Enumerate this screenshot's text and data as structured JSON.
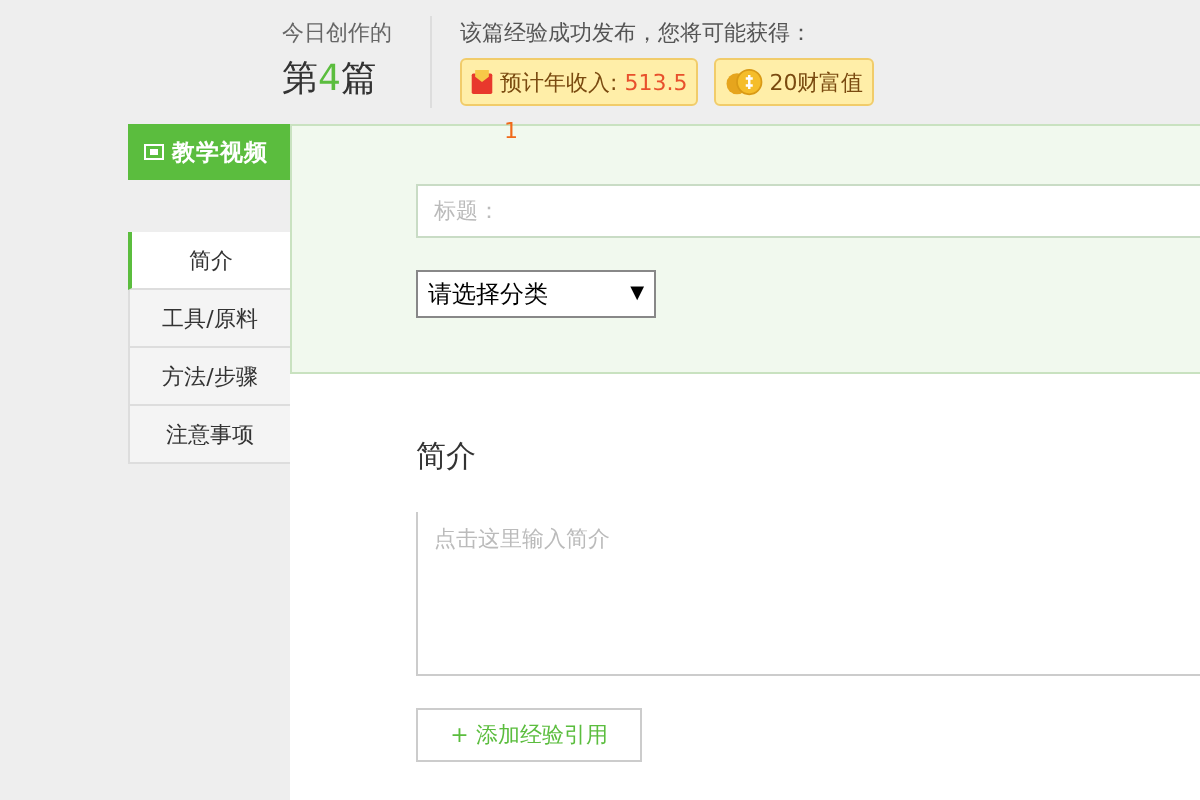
{
  "stats": {
    "label": "今日创作的",
    "count_prefix": "第",
    "count": "4",
    "count_suffix": "篇"
  },
  "reward": {
    "caption": "该篇经验成功发布，您将可能获得：",
    "badges": [
      {
        "kind": "income",
        "label": "预计年收入: ",
        "value": "513.5"
      },
      {
        "kind": "wealth",
        "label": "20财富值"
      }
    ]
  },
  "marker": "1",
  "video_button": "教学视频",
  "tabs": [
    {
      "label": "简介",
      "selected": true
    },
    {
      "label": "工具/原料",
      "selected": false
    },
    {
      "label": "方法/步骤",
      "selected": false
    },
    {
      "label": "注意事项",
      "selected": false
    }
  ],
  "form": {
    "title_placeholder": "标题：",
    "category": "请选择分类",
    "category_arrow": "▼"
  },
  "section": {
    "heading": "简介",
    "placeholder": "点击这里输入简介",
    "add_button": "+ 添加经验引用"
  }
}
